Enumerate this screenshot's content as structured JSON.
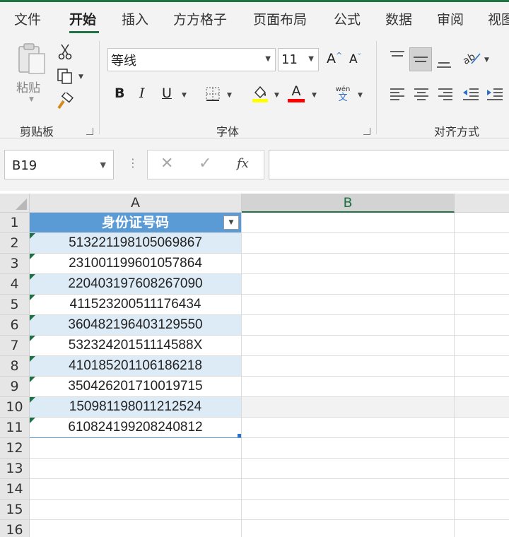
{
  "tabs": [
    {
      "label": "文件"
    },
    {
      "label": "开始"
    },
    {
      "label": "插入"
    },
    {
      "label": "方方格子"
    },
    {
      "label": "页面布局"
    },
    {
      "label": "公式"
    },
    {
      "label": "数据"
    },
    {
      "label": "审阅"
    },
    {
      "label": "视图"
    }
  ],
  "active_tab": "开始",
  "accent_color": "#217346",
  "ribbon": {
    "clipboard": {
      "group_label": "剪贴板",
      "paste_label": "粘贴",
      "icons": [
        "paste-icon",
        "cut-icon",
        "copy-icon",
        "format-painter-icon"
      ]
    },
    "font": {
      "group_label": "字体",
      "font_name": "等线",
      "font_size": "11",
      "grow_label": "A",
      "shrink_label": "A",
      "bold_label": "B",
      "italic_label": "I",
      "underline_label": "U",
      "font_color_label": "A",
      "phonetic_top": "wén",
      "phonetic_bottom": "文",
      "fill_color": "#ffff00",
      "font_color": "#ff0000"
    },
    "alignment": {
      "group_label": "对齐方式"
    }
  },
  "formula_bar": {
    "name_box": "B19",
    "fx_label": "fx",
    "formula": ""
  },
  "sheet": {
    "columns": [
      "A",
      "B"
    ],
    "selected_column": "B",
    "row_numbers": [
      "1",
      "2",
      "3",
      "4",
      "5",
      "6",
      "7",
      "8",
      "9",
      "10",
      "11",
      "12",
      "13",
      "14",
      "15",
      "16"
    ],
    "header_cell": "身份证号码",
    "id_numbers": [
      "513221198105069867",
      "231001199601057864",
      "220403197608267090",
      "411523200511176434",
      "360482196403129550",
      "53232420151114588X",
      "410185201106186218",
      "350426201710019715",
      "150981198011212524",
      "610824199208240812"
    ]
  }
}
